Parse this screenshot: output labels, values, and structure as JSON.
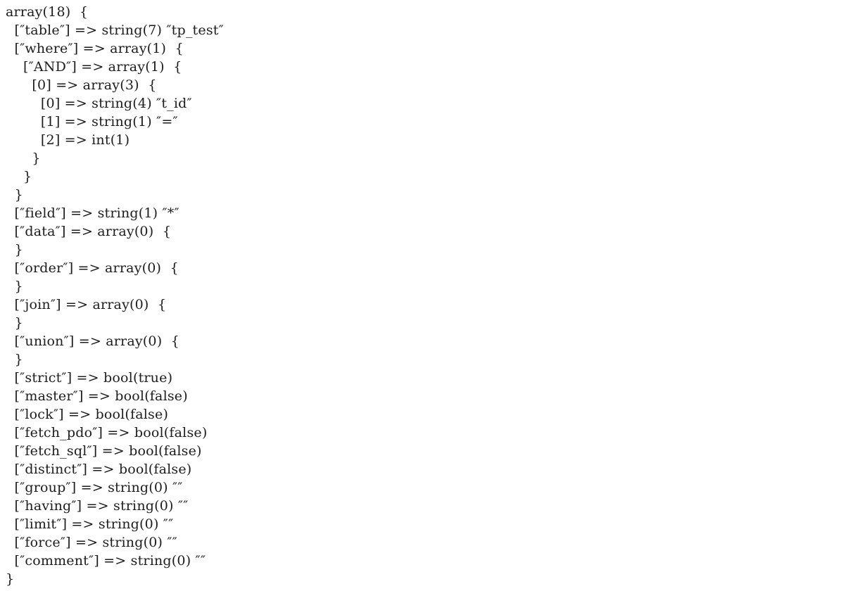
{
  "page": {
    "kind": "php-var-dump-plain-text",
    "background_color": "#ffffff",
    "text_color": "#1c1c1c",
    "font_size_px": 19,
    "line_height_px": 26,
    "indent_unit_spaces": 2,
    "quote_glyph": "″",
    "arrow": "=>"
  },
  "dump": {
    "root_type": "array",
    "root_count": 18,
    "header_line": "array(18)  {",
    "footer_line": "}",
    "lines": [
      "array(18)  {",
      "  [″table″] => string(7) ″tp_test″",
      "  [″where″] => array(1)  {",
      "    [″AND″] => array(1)  {",
      "      [0] => array(3)  {",
      "        [0] => string(4) ″t_id″",
      "        [1] => string(1) ″=″",
      "        [2] => int(1)",
      "      }",
      "    }",
      "  }",
      "  [″field″] => string(1) ″*″",
      "  [″data″] => array(0)  {",
      "  }",
      "  [″order″] => array(0)  {",
      "  }",
      "  [″join″] => array(0)  {",
      "  }",
      "  [″union″] => array(0)  {",
      "  }",
      "  [″strict″] => bool(true)",
      "  [″master″] => bool(false)",
      "  [″lock″] => bool(false)",
      "  [″fetch_pdo″] => bool(false)",
      "  [″fetch_sql″] => bool(false)",
      "  [″distinct″] => bool(false)",
      "  [″group″] => string(0) ″″",
      "  [″having″] => string(0) ″″",
      "  [″limit″] => string(0) ″″",
      "  [″force″] => string(0) ″″",
      "  [″comment″] => string(0) ″″",
      "}"
    ],
    "entries": [
      {
        "key": "table",
        "type": "string",
        "length": 7,
        "value": "tp_test"
      },
      {
        "key": "where",
        "type": "array",
        "count": 1,
        "children": [
          {
            "key": "AND",
            "type": "array",
            "count": 1,
            "children": [
              {
                "key": "0",
                "type": "array",
                "count": 3,
                "children": [
                  {
                    "key": "0",
                    "type": "string",
                    "length": 4,
                    "value": "t_id"
                  },
                  {
                    "key": "1",
                    "type": "string",
                    "length": 1,
                    "value": "="
                  },
                  {
                    "key": "2",
                    "type": "int",
                    "value": 1
                  }
                ]
              }
            ]
          }
        ]
      },
      {
        "key": "field",
        "type": "string",
        "length": 1,
        "value": "*"
      },
      {
        "key": "data",
        "type": "array",
        "count": 0,
        "children": []
      },
      {
        "key": "order",
        "type": "array",
        "count": 0,
        "children": []
      },
      {
        "key": "join",
        "type": "array",
        "count": 0,
        "children": []
      },
      {
        "key": "union",
        "type": "array",
        "count": 0,
        "children": []
      },
      {
        "key": "strict",
        "type": "bool",
        "value": "true"
      },
      {
        "key": "master",
        "type": "bool",
        "value": "false"
      },
      {
        "key": "lock",
        "type": "bool",
        "value": "false"
      },
      {
        "key": "fetch_pdo",
        "type": "bool",
        "value": "false"
      },
      {
        "key": "fetch_sql",
        "type": "bool",
        "value": "false"
      },
      {
        "key": "distinct",
        "type": "bool",
        "value": "false"
      },
      {
        "key": "group",
        "type": "string",
        "length": 0,
        "value": ""
      },
      {
        "key": "having",
        "type": "string",
        "length": 0,
        "value": ""
      },
      {
        "key": "limit",
        "type": "string",
        "length": 0,
        "value": ""
      },
      {
        "key": "force",
        "type": "string",
        "length": 0,
        "value": ""
      },
      {
        "key": "comment",
        "type": "string",
        "length": 0,
        "value": ""
      }
    ]
  }
}
